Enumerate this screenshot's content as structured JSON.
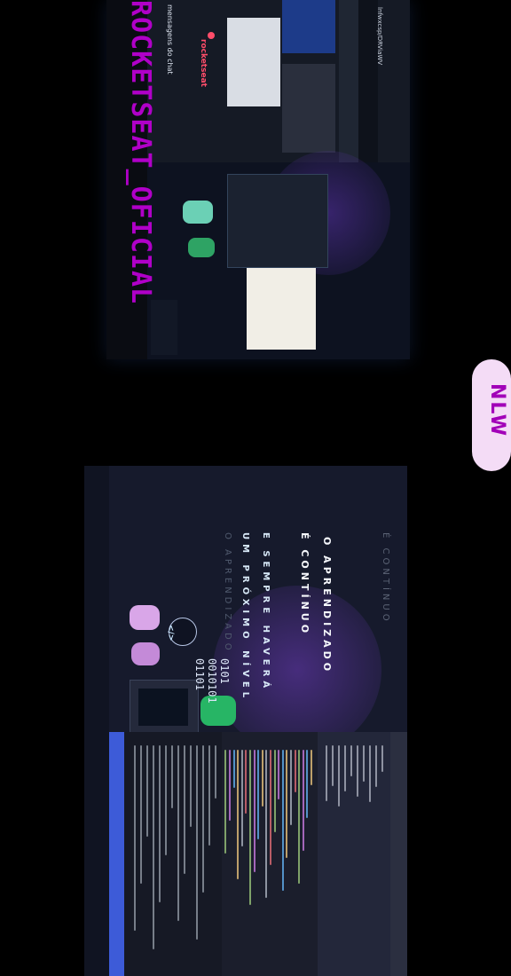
{
  "overlay": {
    "handle": "ROCKETSEAT_OFICIAL",
    "tag": "NLW"
  },
  "top_monitor": {
    "live_label": "mensagens do chat",
    "logo_text": "rocketseat",
    "url_text": "lnfwxcsp/DRViaWV"
  },
  "bottom_monitor": {
    "quote_line1": "O APRENDIZADO",
    "quote_line2": "É CONTÍNUO",
    "quote_line3": "E SEMPRE HAVERÁ",
    "quote_line4": "UM PRÓXIMO NÍVEL",
    "faded_top": "É CONTÍNUO",
    "faded_bottom": "O APRENDIZADO",
    "bubble_code": "</>",
    "binary_lines": [
      "0101",
      "0010101",
      "01101"
    ]
  },
  "colors": {
    "handle_color": "#b000c8",
    "tag_bg": "#f4dcf6",
    "tag_text": "#a200b8",
    "vscode_status": "#3d5bd8"
  }
}
